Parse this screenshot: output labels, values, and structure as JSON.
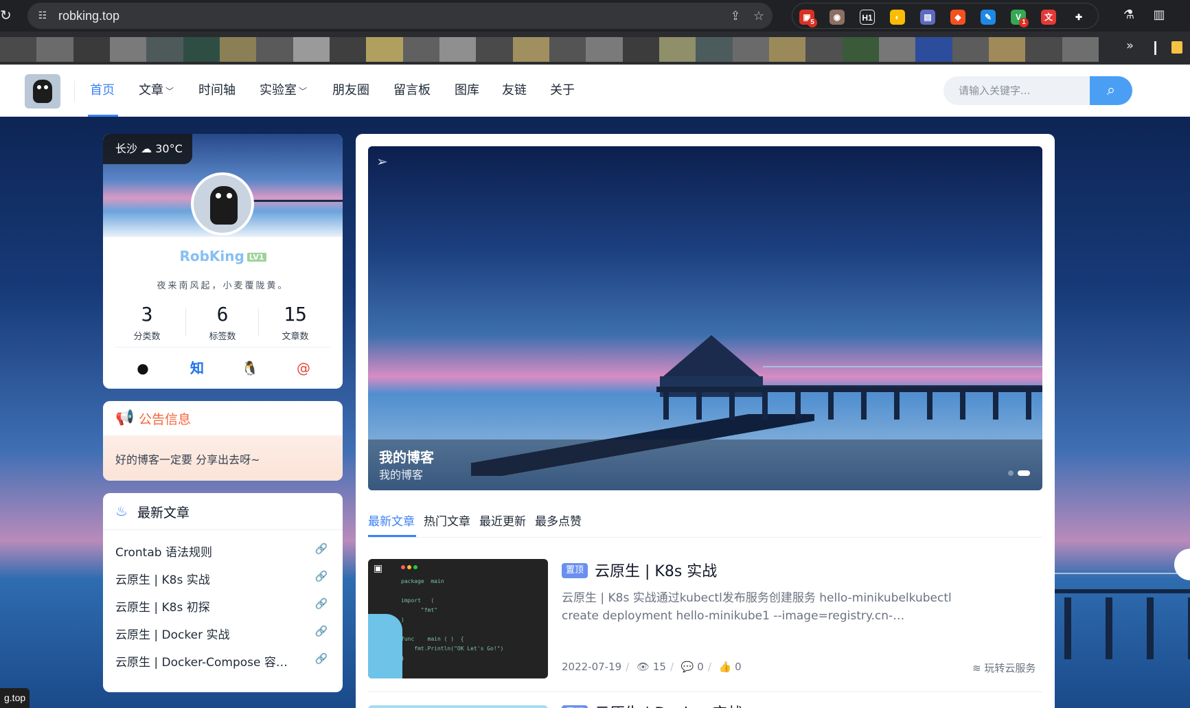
{
  "browser": {
    "url": "robking.top",
    "ext_badges": {
      "ext1": "5",
      "ext2": "1"
    },
    "bookmarks_more": "»"
  },
  "header": {
    "nav": [
      {
        "label": "首页",
        "active": true
      },
      {
        "label": "文章",
        "dropdown": true
      },
      {
        "label": "时间轴"
      },
      {
        "label": "实验室",
        "dropdown": true
      },
      {
        "label": "朋友圈"
      },
      {
        "label": "留言板"
      },
      {
        "label": "图库"
      },
      {
        "label": "友链"
      },
      {
        "label": "关于"
      }
    ],
    "search_placeholder": "请输入关键字..."
  },
  "profile": {
    "city": "长沙",
    "weather": "30°C",
    "name": "RobKing",
    "level": "LV1",
    "motto": "夜来南风起，小麦覆陇黄。",
    "stats": [
      {
        "num": "3",
        "label": "分类数"
      },
      {
        "num": "6",
        "label": "标签数"
      },
      {
        "num": "15",
        "label": "文章数"
      }
    ],
    "social": [
      {
        "name": "github",
        "glyph": "●"
      },
      {
        "name": "zhihu",
        "glyph": "知"
      },
      {
        "name": "qq",
        "glyph": "🐧"
      },
      {
        "name": "email",
        "glyph": "@"
      }
    ]
  },
  "notice": {
    "title": "公告信息",
    "text": "好的博客一定要 分享出去呀~"
  },
  "recent": {
    "title": "最新文章",
    "items": [
      "Crontab 语法规则",
      "云原生 | K8s 实战",
      "云原生 | K8s 初探",
      "云原生 | Docker 实战",
      "云原生 | Docker-Compose 容…"
    ]
  },
  "carousel": {
    "title": "我的博客",
    "subtitle": "我的博客",
    "slides": 2,
    "active_slide": 2
  },
  "tabs": [
    "最新文章",
    "热门文章",
    "最近更新",
    "最多点赞"
  ],
  "posts": [
    {
      "badge": "置顶",
      "title": "云原生 | K8s 实战",
      "excerpt": "云原生 | K8s 实战通过kubectl发布服务创建服务 hello-minikubelkubectl create deployment hello-minikube1 --image=registry.cn-…",
      "date": "2022-07-19",
      "views": "15",
      "comments": "0",
      "likes": "0",
      "category": "玩转云服务",
      "code": "package  main\n\nimport   (\n      \"fmt\"\n)\n\nfunc    main ( )  {\n    fmt.Println(\"OK Let's Go!\")\n}"
    },
    {
      "badge": "置顶",
      "title": "云原生 | Docker 实战"
    }
  ],
  "status_url": "g.top",
  "colors": {
    "accent": "#3b82f6",
    "notice": "#f5663b",
    "badge": "#6a8ff0"
  }
}
